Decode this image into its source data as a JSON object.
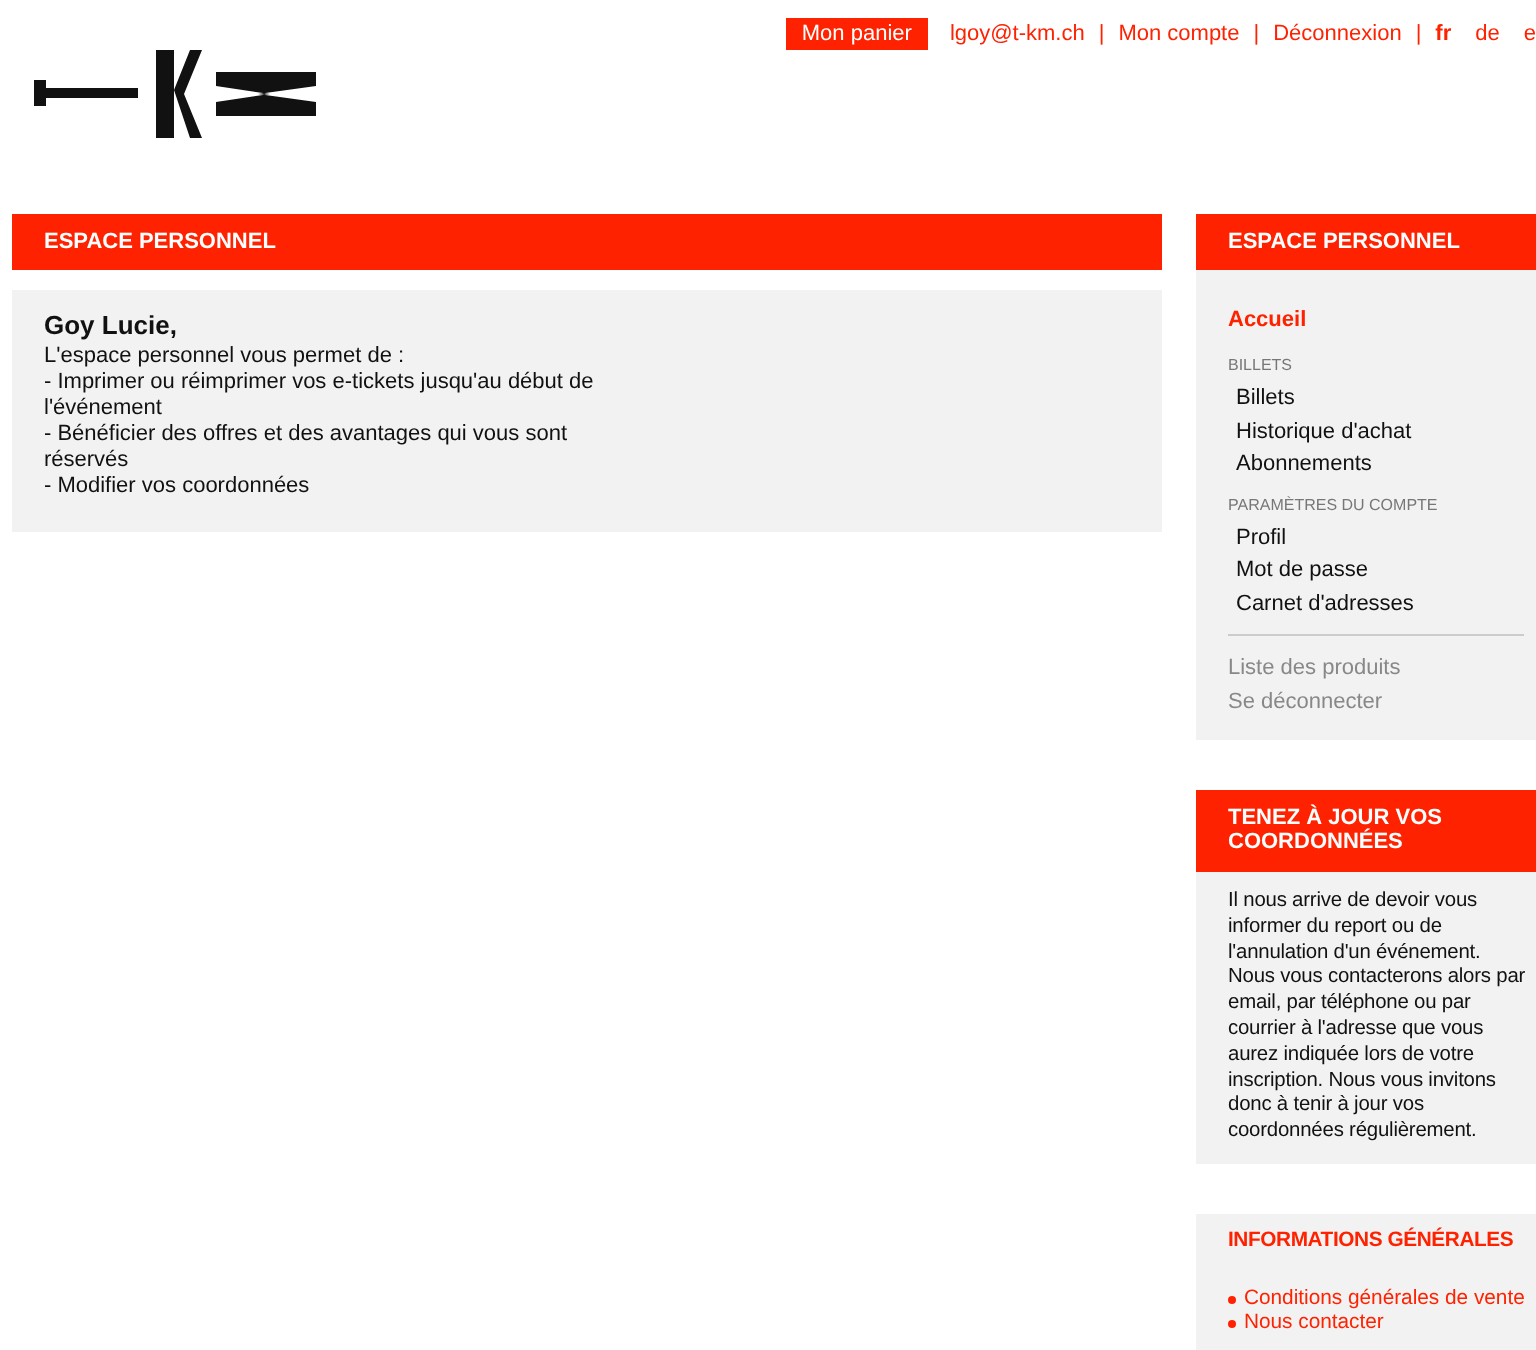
{
  "top_bar": {
    "cart_button": "Mon panier",
    "links": [
      "lgoy@t-km.ch",
      "Mon compte",
      "Déconnexion"
    ],
    "separators": [
      "|",
      "|",
      "|"
    ],
    "languages": [
      {
        "label": "fr",
        "selected": true
      },
      {
        "label": "de",
        "selected": false
      },
      {
        "label": "e",
        "selected": false
      }
    ]
  },
  "main": {
    "title": "ESPACE PERSONNEL",
    "greeting": "Goy Lucie,",
    "lines": [
      "L'espace personnel vous permet de :",
      "- Imprimer ou réimprimer vos e-tickets jusqu'au début de l'événement",
      "- Bénéficier des offres et des avantages qui vous sont réservés",
      "- Modifier vos coordonnées"
    ]
  },
  "sidebar": {
    "title": "ESPACE PERSONNEL",
    "home": {
      "label": "Accueil",
      "selected": true
    },
    "sections": [
      {
        "heading": "BILLETS",
        "items": [
          {
            "label": "Billets",
            "selected": false
          },
          {
            "label": "Historique d'achat",
            "selected": false
          },
          {
            "label": "Abonnements",
            "selected": false
          }
        ]
      },
      {
        "heading": "PARAMÈTRES DU COMPTE",
        "items": [
          {
            "label": "Profil",
            "selected": false
          },
          {
            "label": "Mot de passe",
            "selected": false
          },
          {
            "label": "Carnet d'adresses",
            "selected": false
          }
        ]
      }
    ],
    "footer_links": [
      "Liste des produits",
      "Se déconnecter"
    ]
  },
  "update_box": {
    "title": "TENEZ À JOUR VOS COORDONNÉES",
    "text": "Il nous arrive de devoir vous informer du report ou de l'annulation d'un événement. Nous vous contacterons alors par email, par téléphone ou par courrier à l'adresse que vous aurez indiquée lors de votre inscription. Nous vous invitons donc à tenir à jour vos coordonnées régulièrement."
  },
  "info_box": {
    "title": "INFORMATIONS GÉNÉRALES",
    "links": [
      "Conditions générales de vente",
      "Nous contacter"
    ]
  }
}
